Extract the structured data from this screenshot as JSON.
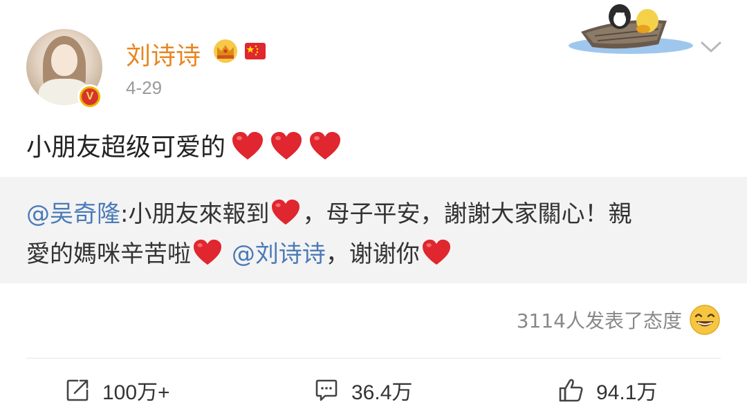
{
  "post": {
    "username": "刘诗诗",
    "date": "4-29",
    "text": "小朋友超级可爱的",
    "hearts_count": 3
  },
  "repost": {
    "mention_author": "@吴奇隆",
    "line1_part1": ":小朋友來報到",
    "line1_part2": "，母子平安，謝謝大家關心！親",
    "line2_part1": "愛的媽咪辛苦啦",
    "line2_mention": "@刘诗诗",
    "line2_part2": "，谢谢你"
  },
  "reactions": {
    "text": "3114人发表了态度"
  },
  "actions": {
    "repost_count": "100万+",
    "comment_count": "36.4万",
    "like_count": "94.1万"
  },
  "colors": {
    "username": "#e8861f",
    "mention": "#4a7ab8",
    "heart": "#e0262f",
    "repost_bg": "#f3f3f3"
  },
  "icons": [
    "crown-icon",
    "china-flag-icon",
    "verified-icon",
    "chevron-down-icon",
    "heart-icon",
    "laugh-emoji-icon",
    "share-icon",
    "comment-icon",
    "thumbs-up-icon"
  ]
}
